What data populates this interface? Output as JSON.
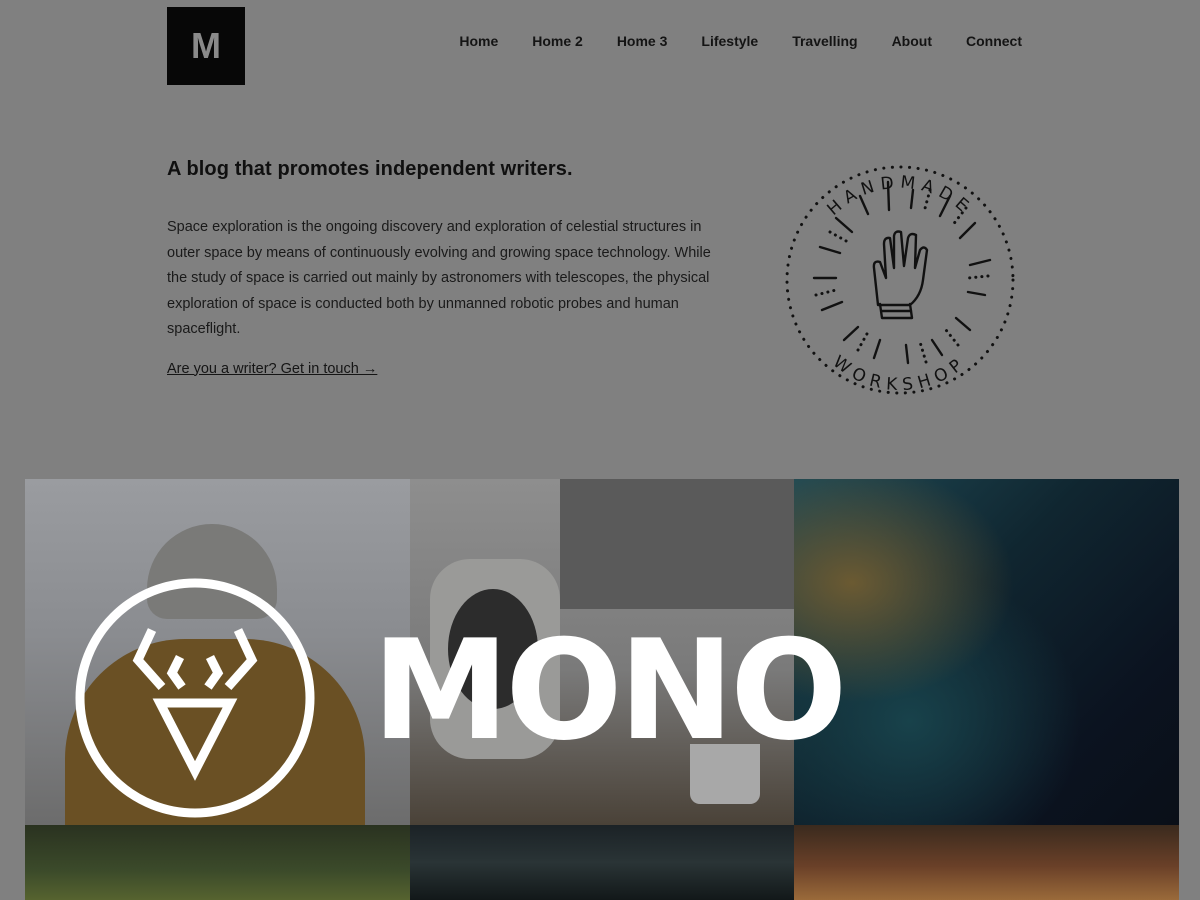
{
  "header": {
    "logo_letter": "M",
    "nav": [
      {
        "label": "Home",
        "active": true
      },
      {
        "label": "Home 2"
      },
      {
        "label": "Home 3"
      },
      {
        "label": "Lifestyle"
      },
      {
        "label": "Travelling"
      },
      {
        "label": "About"
      },
      {
        "label": "Connect"
      }
    ]
  },
  "intro": {
    "title": "A blog that promotes independent writers.",
    "body": "Space exploration is the ongoing discovery and exploration of celestial structures in outer space by means of continuously evolving and growing space technology. While the study of space is carried out mainly by astronomers with telescopes, the physical exploration of space is conducted both by unmanned robotic probes and human spaceflight.",
    "cta": "Are you a writer? Get in touch →"
  },
  "badge": {
    "top_text": "HANDMADE",
    "bottom_text": "WORKSHOP",
    "icon": "hand-icon"
  },
  "gallery": {
    "tiles": [
      "person-in-beanie-photo",
      "desk-speaker-photo",
      "aerial-ocean-photo",
      "forest-photo",
      "skylight-photo",
      "wooden-ceiling-photo"
    ]
  },
  "overlay": {
    "brand": "MONO",
    "icon": "deer-head-icon"
  },
  "colors": {
    "page_bg": "#808080",
    "logo_bg": "#070707",
    "overlay_text": "#ffffff"
  }
}
